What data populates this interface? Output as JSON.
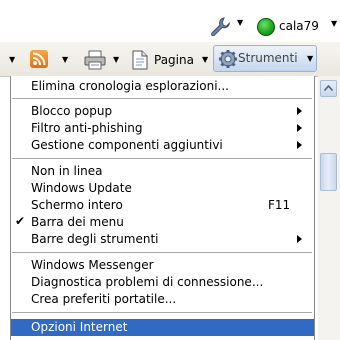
{
  "topbar": {
    "wrench_icon": "wrench-icon",
    "user": "cala79",
    "status_color": "#22a822"
  },
  "toolbar": {
    "page_label": "Pagina",
    "tools_label": "Strumenti"
  },
  "menu": {
    "items": [
      {
        "label": "Elimina cronologia esplorazioni..."
      },
      {
        "label": "Blocco popup",
        "submenu": true
      },
      {
        "label": "Filtro anti-phishing",
        "submenu": true
      },
      {
        "label": "Gestione componenti aggiuntivi",
        "submenu": true
      },
      {
        "label": "Non in linea"
      },
      {
        "label": "Windows Update"
      },
      {
        "label": "Schermo intero",
        "shortcut": "F11"
      },
      {
        "label": "Barra dei menu",
        "checked": true
      },
      {
        "label": "Barre degli strumenti",
        "submenu": true
      },
      {
        "label": "Windows Messenger"
      },
      {
        "label": "Diagnostica problemi di connessione..."
      },
      {
        "label": "Crea preferiti portatile..."
      },
      {
        "label": "Opzioni Internet",
        "highlighted": true
      }
    ]
  },
  "colors": {
    "highlight": "#316ac5",
    "tools_button": "#c5d6ee"
  }
}
